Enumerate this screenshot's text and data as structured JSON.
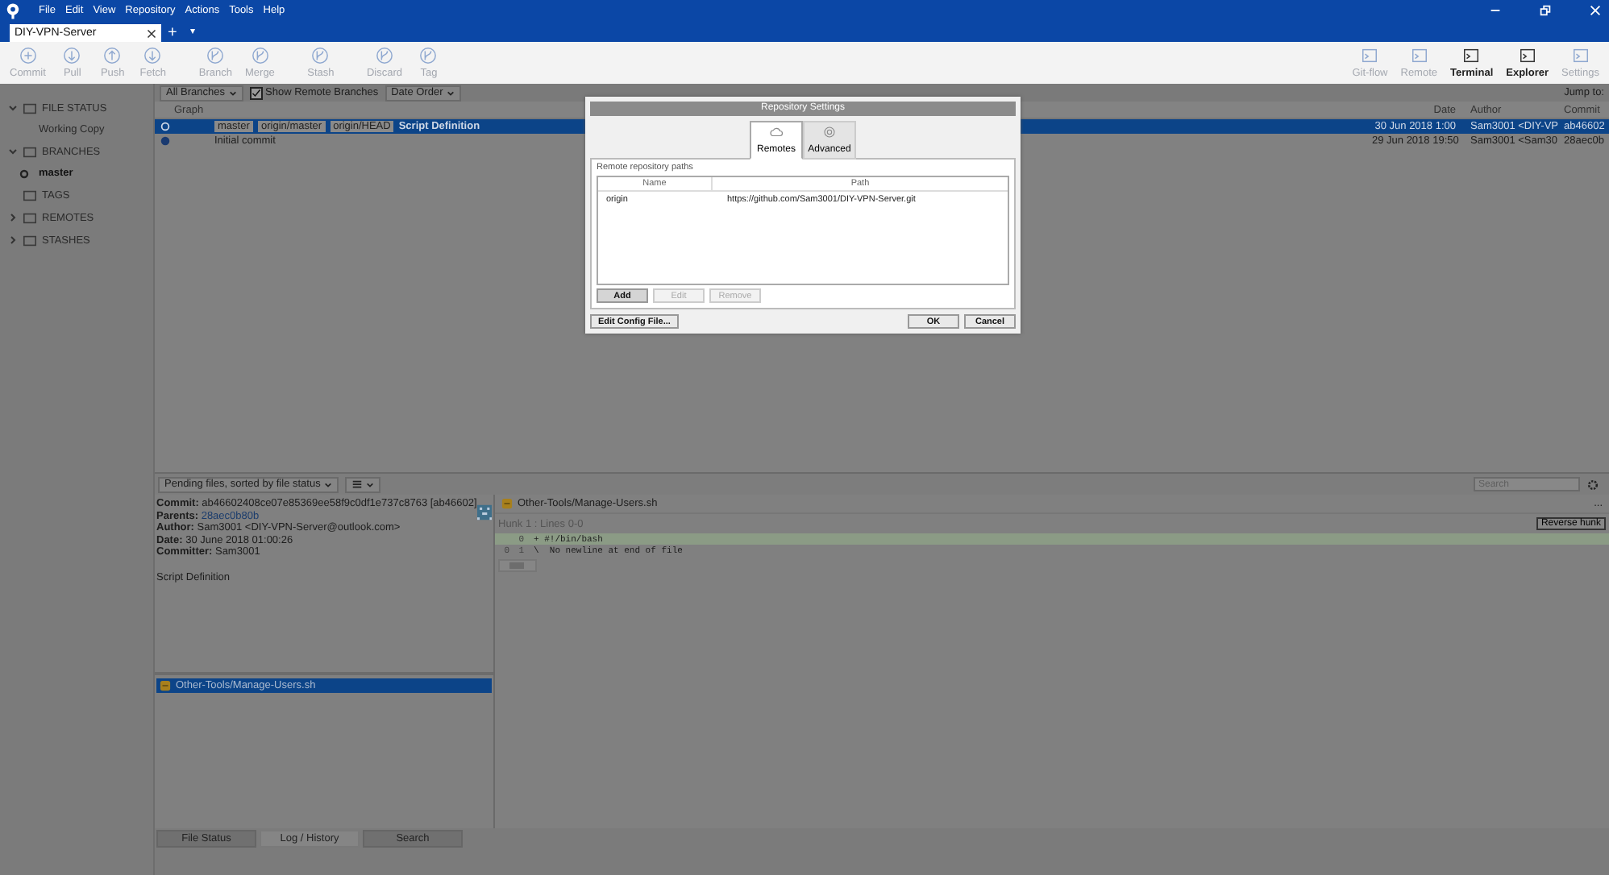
{
  "menu": [
    "File",
    "Edit",
    "View",
    "Repository",
    "Actions",
    "Tools",
    "Help"
  ],
  "repo_tabs": [
    {
      "label": "DIY-VPN-Server",
      "selected": true
    }
  ],
  "new_tab": "+",
  "tab_menu": "▾",
  "toolbar_left": [
    {
      "label": "Commit",
      "disabled": true
    },
    {
      "label": "Pull",
      "disabled": true
    },
    {
      "label": "Push",
      "disabled": true
    },
    {
      "label": "Fetch",
      "disabled": true
    },
    {
      "label": "Branch",
      "disabled": true
    },
    {
      "label": "Merge",
      "disabled": true
    },
    {
      "label": "Stash",
      "disabled": true
    },
    {
      "label": "Discard",
      "disabled": true
    },
    {
      "label": "Tag",
      "disabled": true
    }
  ],
  "toolbar_right": [
    {
      "label": "Git-flow",
      "disabled": true
    },
    {
      "label": "Remote",
      "disabled": true
    },
    {
      "label": "Terminal",
      "disabled": false
    },
    {
      "label": "Explorer",
      "disabled": false
    },
    {
      "label": "Settings",
      "disabled": true
    }
  ],
  "sidebar": {
    "items": [
      {
        "label": "FILE STATUS",
        "kind": "section",
        "expanded": true
      },
      {
        "label": "Working Copy",
        "kind": "item",
        "current": false
      },
      {
        "label": "BRANCHES",
        "kind": "section",
        "expanded": true
      },
      {
        "label": "master",
        "kind": "item",
        "current": true
      },
      {
        "label": "TAGS",
        "kind": "section"
      },
      {
        "label": "REMOTES",
        "kind": "section",
        "expanded": false
      },
      {
        "label": "STASHES",
        "kind": "section",
        "expanded": false
      }
    ]
  },
  "filter": {
    "branches": "All Branches",
    "show_remote": {
      "label": "Show Remote Branches",
      "checked": true
    },
    "order": "Date Order",
    "jump": "Jump to:"
  },
  "log": {
    "columns": [
      "Graph",
      "Date",
      "Author",
      "Commit"
    ],
    "rows": [
      {
        "refs": [
          "master",
          "origin/master",
          "origin/HEAD"
        ],
        "message": "Script Definition",
        "date": "30 Jun 2018 1:00",
        "author": "Sam3001 <DIY-VP",
        "commit": "ab46602",
        "selected": true
      },
      {
        "refs": [],
        "message": "Initial commit",
        "date": "29 Jun 2018 19:50",
        "author": "Sam3001 <Sam30",
        "commit": "28aec0b",
        "selected": false
      }
    ]
  },
  "details": {
    "sort": "Pending files, sorted by file status",
    "search_placeholder": "Search",
    "fields": [
      {
        "label": "Commit:",
        "value": "ab46602408ce07e85369ee58f9c0df1e737c8763 [ab46602]",
        "kind": "text"
      },
      {
        "label": "Parents:",
        "value": "28aec0b80b",
        "kind": "link"
      },
      {
        "label": "Author:",
        "value": "Sam3001 <DIY-VPN-Server@outlook.com>",
        "kind": "text"
      },
      {
        "label": "Date:",
        "value": "30 June 2018 01:00:26",
        "kind": "text"
      },
      {
        "label": "Committer:",
        "value": "Sam3001",
        "kind": "text"
      }
    ],
    "message": "Script Definition",
    "files": [
      {
        "name": "Other-Tools/Manage-Users.sh",
        "selected": true
      }
    ]
  },
  "diff": {
    "file": "Other-Tools/Manage-Users.sh",
    "more": "...",
    "hunk": "Hunk 1 : Lines 0-0",
    "reverse": "Reverse hunk",
    "lines": [
      {
        "new": "0",
        "text": "+ #!/bin/bash",
        "kind": "added"
      },
      {
        "old": "0",
        "new": "1",
        "text": "\\  No newline at end of file",
        "kind": "context"
      }
    ]
  },
  "bottom_tabs": [
    {
      "label": "File Status",
      "selected": false
    },
    {
      "label": "Log / History",
      "selected": true
    },
    {
      "label": "Search",
      "selected": false
    }
  ],
  "dialog": {
    "title": "Repository Settings",
    "tabs": [
      {
        "label": "Remotes",
        "selected": true
      },
      {
        "label": "Advanced",
        "selected": false
      }
    ],
    "section": "Remote repository paths",
    "columns": [
      "Name",
      "Path"
    ],
    "rows": [
      {
        "name": "origin",
        "path": "https://github.com/Sam3001/DIY-VPN-Server.git"
      }
    ],
    "buttons": [
      {
        "label": "Add",
        "disabled": false
      },
      {
        "label": "Edit",
        "disabled": true
      },
      {
        "label": "Remove",
        "disabled": true
      }
    ],
    "config": "Edit Config File...",
    "ok": "OK",
    "cancel": "Cancel"
  }
}
